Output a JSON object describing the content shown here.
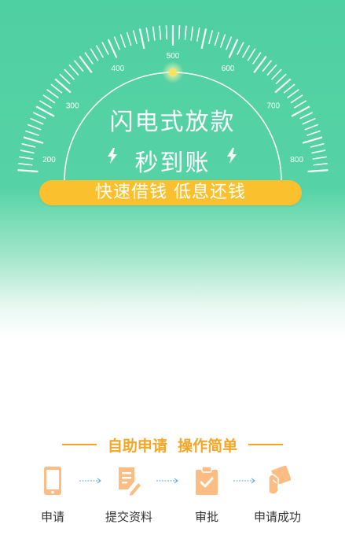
{
  "gauge": {
    "tick_labels": [
      "200",
      "300",
      "400",
      "500",
      "600",
      "700",
      "800"
    ],
    "indicator_value": 500,
    "colors": {
      "ring": "#ffffff",
      "indicator": "#ffe25a"
    }
  },
  "hero": {
    "headline": "闪电式放款",
    "subheadline": "秒到账",
    "banner": "快速借钱 低息还钱",
    "colors": {
      "background": "#52d1a4",
      "banner": "#fbc02d"
    }
  },
  "steps": {
    "title": "自助申请  操作简单",
    "items": [
      {
        "label": "申请",
        "icon": "phone-icon"
      },
      {
        "label": "提交资料",
        "icon": "document-edit-icon"
      },
      {
        "label": "审批",
        "icon": "clipboard-check-icon"
      },
      {
        "label": "申请成功",
        "icon": "hand-card-icon"
      }
    ],
    "colors": {
      "accent": "#f5a623",
      "icon": "#fbbd83"
    }
  }
}
